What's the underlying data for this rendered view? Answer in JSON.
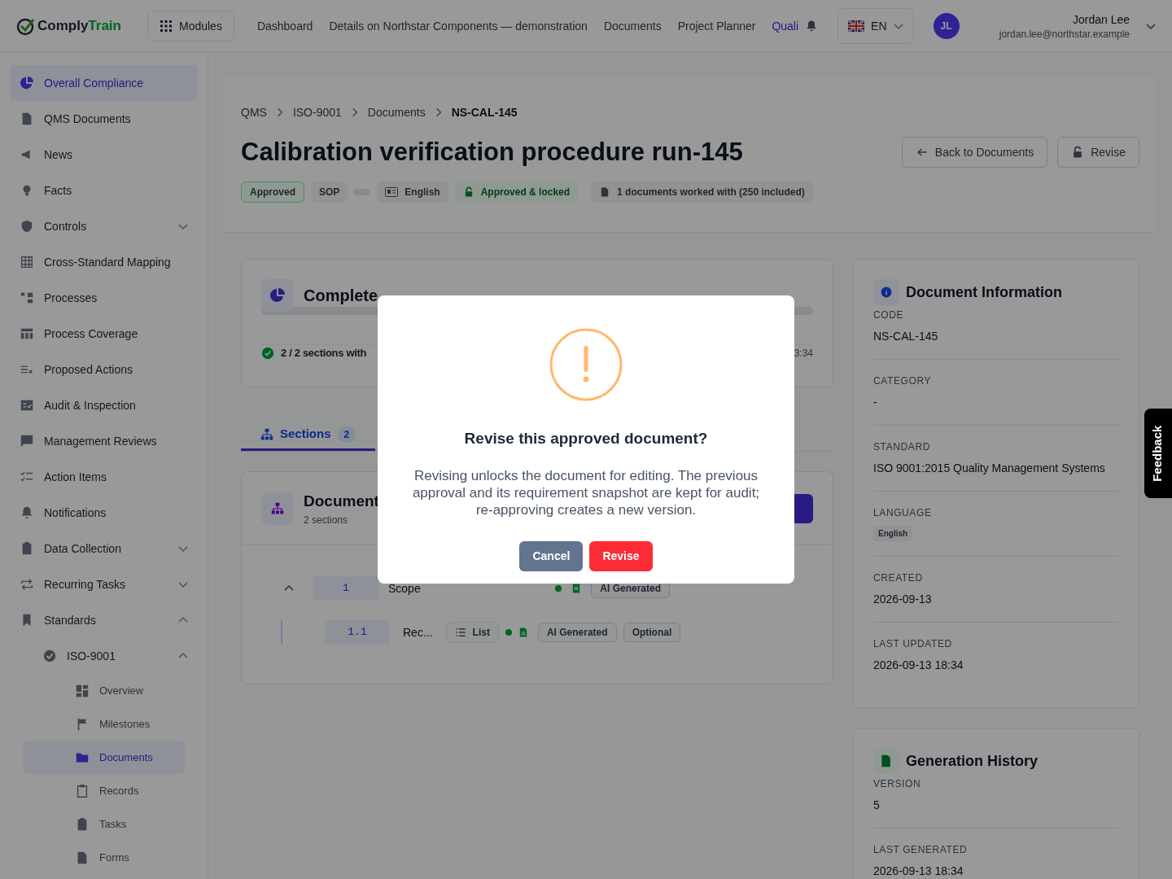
{
  "topbar": {
    "logo": [
      "Comply",
      "Train"
    ],
    "modules_button": "Modules",
    "nav": [
      {
        "label": "Dashboard",
        "selected": false
      },
      {
        "label": "Details on Northstar Components — demonstration",
        "selected": false
      },
      {
        "label": "Documents",
        "selected": false
      },
      {
        "label": "Project Planner",
        "selected": false
      },
      {
        "label": "Quali",
        "selected": true
      }
    ],
    "language": "EN",
    "user": {
      "initials": "JL",
      "name": "Jordan Lee",
      "email": "jordan.lee@northstar.example"
    }
  },
  "sidebar": {
    "items": [
      {
        "label": "Overall Compliance",
        "selected": true
      },
      {
        "label": "QMS Documents",
        "selected": false
      },
      {
        "label": "News",
        "selected": false
      },
      {
        "label": "Facts",
        "selected": false
      },
      {
        "label": "Controls",
        "selected": false,
        "expanded": false
      },
      {
        "label": "Cross-Standard Mapping",
        "selected": false
      },
      {
        "label": "Processes",
        "selected": false
      },
      {
        "label": "Process Coverage",
        "selected": false
      },
      {
        "label": "Proposed Actions",
        "selected": false
      },
      {
        "label": "Audit & Inspection",
        "selected": false
      },
      {
        "label": "Management Reviews",
        "selected": false
      },
      {
        "label": "Action Items",
        "selected": false
      },
      {
        "label": "Notifications",
        "selected": false
      },
      {
        "label": "Data Collection",
        "selected": false,
        "expanded": false
      },
      {
        "label": "Recurring Tasks",
        "selected": false,
        "expanded": false
      },
      {
        "label": "Standards",
        "selected": false,
        "expanded": true,
        "children": [
          {
            "label": "ISO-9001",
            "selected": false,
            "expanded": true,
            "children": [
              {
                "label": "Overview",
                "selected": false
              },
              {
                "label": "Milestones",
                "selected": false
              },
              {
                "label": "Documents",
                "selected": true
              },
              {
                "label": "Records",
                "selected": false
              },
              {
                "label": "Tasks",
                "selected": false
              },
              {
                "label": "Forms",
                "selected": false
              }
            ]
          }
        ]
      }
    ]
  },
  "header": {
    "breadcrumbs": [
      "QMS",
      "ISO-9001",
      "Documents",
      "NS-CAL-145"
    ],
    "title": "Calibration verification procedure run-145",
    "badges": [
      {
        "kind": "status",
        "label": "Approved"
      },
      {
        "kind": "plain",
        "label": "SOP"
      },
      {
        "kind": "empty"
      },
      {
        "kind": "language",
        "label": "English"
      },
      {
        "kind": "locked",
        "label": "Approved & locked"
      },
      {
        "kind": "usage",
        "label": "1 documents worked with (250 included)"
      }
    ],
    "buttons": [
      "Back to Documents",
      "Revise"
    ]
  },
  "completeness": {
    "title": "Complete",
    "summary": "2 / 2 sections with",
    "time": "3:34"
  },
  "tabs": [
    {
      "label": "Sections",
      "count": "2",
      "selected": true
    }
  ],
  "document_card": {
    "title": "Document",
    "subtitle": "2 sections",
    "sections": [
      {
        "number": "1",
        "title": "Scope",
        "badges": [
          "AI Generated"
        ],
        "expanded": true,
        "children": [
          {
            "number": "1.1",
            "title": "Rec...",
            "type": "List",
            "badges": [
              "AI Generated",
              "Optional"
            ]
          }
        ]
      }
    ]
  },
  "document_information": {
    "title": "Document Information",
    "fields": [
      {
        "label": "CODE",
        "value": "NS-CAL-145",
        "kind": "text"
      },
      {
        "label": "CATEGORY",
        "value": "-",
        "kind": "text"
      },
      {
        "label": "STANDARD",
        "value": "ISO 9001:2015 Quality Management Systems",
        "kind": "text"
      },
      {
        "label": "LANGUAGE",
        "value": "English",
        "kind": "badge"
      },
      {
        "label": "CREATED",
        "value": "2026-09-13",
        "kind": "text"
      },
      {
        "label": "LAST UPDATED",
        "value": "2026-09-13 18:34",
        "kind": "text"
      }
    ]
  },
  "generation_history": {
    "title": "Generation History",
    "fields": [
      {
        "label": "VERSION",
        "value": "5",
        "kind": "text"
      },
      {
        "label": "LAST GENERATED",
        "value": "2026-09-13 18:34",
        "kind": "text"
      }
    ]
  },
  "dialog": {
    "title": "Revise this approved document?",
    "message": "Revising unlocks the document for editing. The previous approval and its requirement snapshot are kept for audit; re-approving creates a new version.",
    "buttons": [
      "Cancel",
      "Revise"
    ]
  },
  "feedback": "Feedback"
}
